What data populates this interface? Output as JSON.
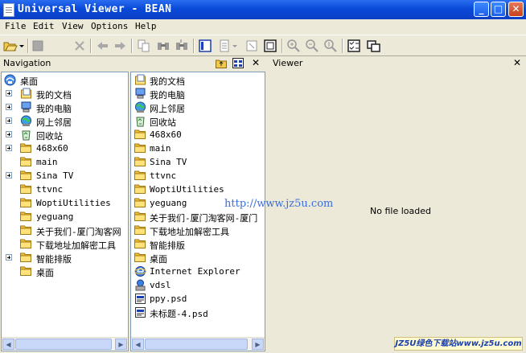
{
  "window": {
    "title": "Universal Viewer - BEAN"
  },
  "menu": [
    "File",
    "Edit",
    "View",
    "Options",
    "Help"
  ],
  "toolbar": {
    "icons": [
      "open-icon",
      "dropdown-icon",
      "stop-icon",
      "delete-icon",
      "back-icon",
      "forward-icon",
      "copy-icon",
      "find-icon",
      "find-next-icon",
      "view-mode-icon",
      "text-icon",
      "fit-icon",
      "fullscreen-icon",
      "zoom-in-icon",
      "zoom-out-icon",
      "zoom-reset-icon",
      "checkbox-icon",
      "windows-icon"
    ]
  },
  "navigation": {
    "label": "Navigation",
    "tree": [
      {
        "label": "桌面",
        "icon": "desktop-icon",
        "expander": false,
        "indent": 0
      },
      {
        "label": "我的文档",
        "icon": "documents-icon",
        "expander": true,
        "indent": 1
      },
      {
        "label": "我的电脑",
        "icon": "computer-icon",
        "expander": true,
        "indent": 1
      },
      {
        "label": "网上邻居",
        "icon": "network-icon",
        "expander": true,
        "indent": 1
      },
      {
        "label": "回收站",
        "icon": "recycle-bin-icon",
        "expander": true,
        "indent": 1
      },
      {
        "label": "468x60",
        "icon": "folder-icon",
        "expander": true,
        "indent": 1
      },
      {
        "label": "main",
        "icon": "folder-icon",
        "expander": false,
        "indent": 1
      },
      {
        "label": "Sina TV",
        "icon": "folder-icon",
        "expander": true,
        "indent": 1
      },
      {
        "label": "ttvnc",
        "icon": "folder-icon",
        "expander": false,
        "indent": 1
      },
      {
        "label": "WoptiUtilities",
        "icon": "folder-icon",
        "expander": false,
        "indent": 1
      },
      {
        "label": "yeguang",
        "icon": "folder-icon",
        "expander": false,
        "indent": 1
      },
      {
        "label": "关于我们-厦门淘客网",
        "icon": "folder-icon",
        "expander": false,
        "indent": 1
      },
      {
        "label": "下载地址加解密工具",
        "icon": "folder-icon",
        "expander": false,
        "indent": 1
      },
      {
        "label": "智能排版",
        "icon": "folder-icon",
        "expander": true,
        "indent": 1
      },
      {
        "label": "桌面",
        "icon": "folder-icon",
        "expander": false,
        "indent": 1
      }
    ]
  },
  "list": [
    {
      "label": "我的文档",
      "icon": "documents-icon"
    },
    {
      "label": "我的电脑",
      "icon": "computer-icon"
    },
    {
      "label": "网上邻居",
      "icon": "network-icon"
    },
    {
      "label": "回收站",
      "icon": "recycle-bin-icon"
    },
    {
      "label": "468x60",
      "icon": "folder-icon"
    },
    {
      "label": "main",
      "icon": "folder-icon"
    },
    {
      "label": "Sina TV",
      "icon": "folder-icon"
    },
    {
      "label": "ttvnc",
      "icon": "folder-icon"
    },
    {
      "label": "WoptiUtilities",
      "icon": "folder-icon"
    },
    {
      "label": "yeguang",
      "icon": "folder-icon"
    },
    {
      "label": "关于我们-厦门淘客网-厦门",
      "icon": "folder-icon"
    },
    {
      "label": "下载地址加解密工具",
      "icon": "folder-icon"
    },
    {
      "label": "智能排版",
      "icon": "folder-icon"
    },
    {
      "label": "桌面",
      "icon": "folder-icon"
    },
    {
      "label": "Internet Explorer",
      "icon": "ie-icon"
    },
    {
      "label": "vdsl",
      "icon": "connection-icon"
    },
    {
      "label": "ppy.psd",
      "icon": "psd-file-icon"
    },
    {
      "label": "未标题-4.psd",
      "icon": "psd-file-icon"
    }
  ],
  "viewer": {
    "label": "Viewer",
    "message": "No file loaded"
  },
  "watermark": "http://www.jz5u.com",
  "footer_logo": "JZ5U绿色下载站www.jz5u.com"
}
